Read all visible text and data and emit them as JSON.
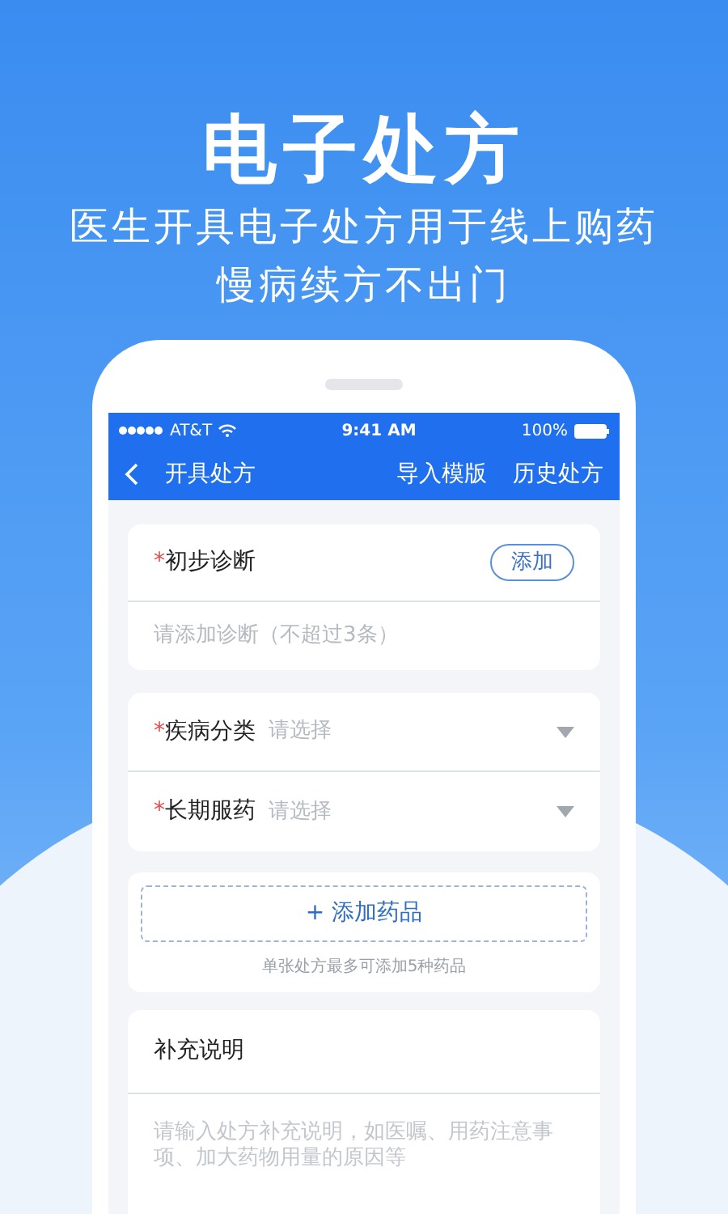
{
  "headline": "电子处方",
  "subtitle_lines": [
    "医生开具电子处方用于线上购药",
    "慢病续方不出门"
  ],
  "status_bar": {
    "carrier": "AT&T",
    "time": "9:41 AM",
    "battery": "100%"
  },
  "nav": {
    "title": "开具处方",
    "actions": [
      "导入模版",
      "历史处方"
    ]
  },
  "diagnosis": {
    "required_mark": "*",
    "label": "初步诊断",
    "button": "添加",
    "placeholder": "请添加诊断（不超过3条）"
  },
  "selects": [
    {
      "required_mark": "*",
      "label": "疾病分类",
      "placeholder": "请选择"
    },
    {
      "required_mark": "*",
      "label": "长期服药",
      "placeholder": "请选择"
    }
  ],
  "drugs": {
    "button": "+ 添加药品",
    "note": "单张处方最多可添加5种药品"
  },
  "notes": {
    "label": "补充说明",
    "placeholder": "请输入处方补充说明，如医嘱、用药注意事项、加大药物用量的原因等"
  }
}
